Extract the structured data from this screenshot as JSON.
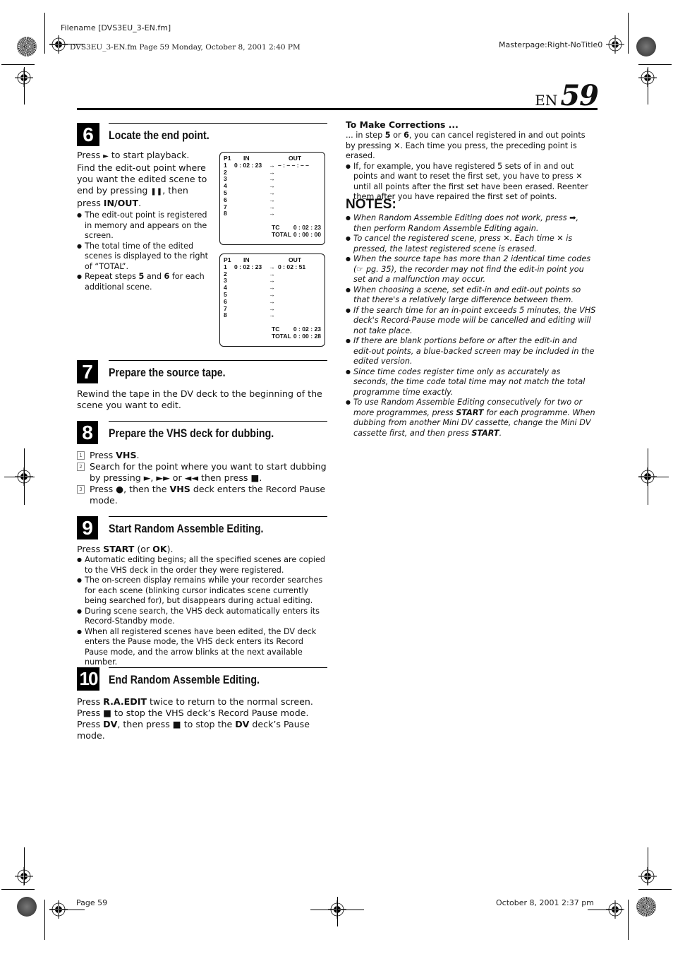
{
  "print_marks": {
    "filename": "Filename [DVS3EU_3-EN.fm]",
    "file_info": "DVS3EU_3-EN.fm  Page 59  Monday, October 8, 2001  2:40 PM",
    "masterpage": "Masterpage:Right-NoTitle0",
    "footer_page": "Page 59",
    "footer_date": "October 8, 2001 2:37 pm"
  },
  "header": {
    "lang": "EN",
    "page_number": "59"
  },
  "steps": [
    {
      "number": "6",
      "title": "Locate the end point.",
      "intro": [
        {
          "t": "Press "
        },
        {
          "t": "►",
          "sym": true
        },
        {
          "t": " to start playback. Find the edit-out point where you want the edited scene to end by pressing "
        },
        {
          "t": "❚❚",
          "sym": true
        },
        {
          "t": ", then press "
        },
        {
          "t": "IN/OUT",
          "b": true
        },
        {
          "t": "."
        }
      ],
      "bullets": [
        "The edit-out point is registered in memory and appears on the screen.",
        "The total time of the edited scenes is displayed to the right of “TOTAL”.",
        "Repeat steps 5 and 6 for each additional scene."
      ]
    },
    {
      "number": "7",
      "title": "Prepare the source tape.",
      "body": "Rewind the tape in the DV deck to the beginning of the scene you want to edit."
    },
    {
      "number": "8",
      "title": "Prepare the VHS deck for dubbing.",
      "items": [
        {
          "n": "1",
          "text": "Press VHS."
        },
        {
          "n": "2",
          "text": "Search for the point where you want to start dubbing by pressing ►, ►► or ◄◄ then press ■."
        },
        {
          "n": "3",
          "text": "Press ●, then the VHS deck enters the Record Pause mode."
        }
      ]
    },
    {
      "number": "9",
      "title": "Start Random Assemble Editing.",
      "intro": "Press START (or OK).",
      "bullets": [
        "Automatic editing begins; all the specified scenes are copied to the VHS deck in the order they were registered.",
        "The on-screen display remains while your recorder searches for each scene (blinking cursor indicates scene currently being searched for), but disappears during actual editing.",
        "During scene search, the VHS deck automatically enters its Record-Standby mode.",
        "When all registered scenes have been edited, the DV deck enters the Pause mode, the VHS deck enters its Record Pause mode, and the arrow blinks at the next available number."
      ]
    },
    {
      "number": "10",
      "title": "End Random Assemble Editing.",
      "lines": [
        "Press R.A.EDIT twice to return to the normal screen.",
        "Press ■ to stop the VHS deck’s Record Pause mode.",
        "Press DV, then press ■ to stop the DV deck’s Pause mode."
      ]
    }
  ],
  "osd_screens": [
    {
      "program": "P1",
      "in_label": "IN",
      "out_label": "OUT",
      "rows": [
        {
          "n": "1",
          "in": "0 : 02 : 23",
          "out": "– : – – : – –"
        },
        {
          "n": "2",
          "in": "",
          "out": ""
        },
        {
          "n": "3",
          "in": "",
          "out": ""
        },
        {
          "n": "4",
          "in": "",
          "out": ""
        },
        {
          "n": "5",
          "in": "",
          "out": ""
        },
        {
          "n": "6",
          "in": "",
          "out": ""
        },
        {
          "n": "7",
          "in": "",
          "out": ""
        },
        {
          "n": "8",
          "in": "",
          "out": ""
        }
      ],
      "tc_label": "TC",
      "tc": "0 : 02 : 23",
      "total_label": "TOTAL",
      "total": "0 : 00 : 00"
    },
    {
      "program": "P1",
      "in_label": "IN",
      "out_label": "OUT",
      "rows": [
        {
          "n": "1",
          "in": "0 : 02 : 23",
          "out": "0 : 02 : 51"
        },
        {
          "n": "2",
          "in": "",
          "out": ""
        },
        {
          "n": "3",
          "in": "",
          "out": ""
        },
        {
          "n": "4",
          "in": "",
          "out": ""
        },
        {
          "n": "5",
          "in": "",
          "out": ""
        },
        {
          "n": "6",
          "in": "",
          "out": ""
        },
        {
          "n": "7",
          "in": "",
          "out": ""
        },
        {
          "n": "8",
          "in": "",
          "out": ""
        }
      ],
      "tc_label": "TC",
      "tc": "0 : 02 : 23",
      "total_label": "TOTAL",
      "total": "0 : 00 : 28"
    }
  ],
  "corrections": {
    "heading": "To Make Corrections ...",
    "body": "... in step 5 or 6, you can cancel registered in and out points by pressing ✕. Each time you press, the preceding point is erased.",
    "bullet": "If, for example, you have registered 5 sets of in and out points and want to reset the first set, you have to press ✕ until all points after the first set have been erased. Reenter them after you have repaired the first set of points."
  },
  "notes": {
    "heading": "NOTES:",
    "items": [
      "When Random Assemble Editing does not work, press ➡, then perform Random Assemble Editing again.",
      "To cancel the registered scene, press ✕. Each time ✕  is pressed, the latest registered scene is erased.",
      "When the source tape has more than 2 identical time codes (☞ pg. 35), the recorder may not find the edit-in point you set and a malfunction may occur.",
      "When choosing a scene, set edit-in and edit-out points so that there's a relatively large difference between them.",
      "If the search time for an in-point exceeds 5 minutes, the VHS deck's Record-Pause mode will be cancelled and editing will not take place.",
      "If there are blank portions before or after the edit-in and edit-out points, a blue-backed screen may be included in the edited version.",
      "Since time codes register time only as accurately as seconds, the time code total time may not match the total programme time exactly.",
      "To use Random Assemble Editing consecutively for two or more programmes, press START for each programme. When dubbing from another Mini DV cassette, change the Mini DV cassette first, and then press START."
    ]
  }
}
